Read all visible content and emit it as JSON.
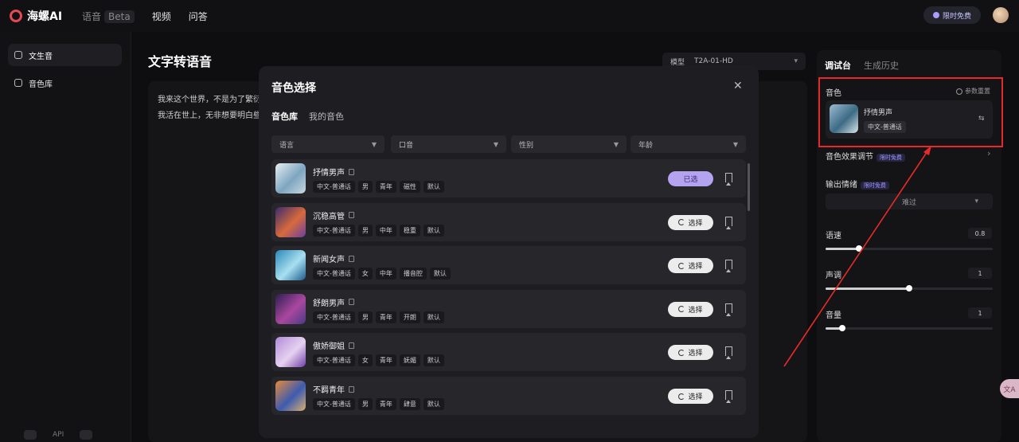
{
  "header": {
    "brand": "海螺AI",
    "nav": [
      {
        "label": "语音",
        "badge": "Beta"
      },
      {
        "label": "视频"
      },
      {
        "label": "问答"
      }
    ],
    "promo_label": "限时免费"
  },
  "sidebar": {
    "items": [
      {
        "label": "文生音",
        "active": true
      },
      {
        "label": "音色库",
        "active": false
      }
    ],
    "bottom": {
      "api_label": "API"
    }
  },
  "main": {
    "title": "文字转语音",
    "model_label": "模型",
    "model_value": "T2A-01-HD",
    "text_lines": [
      "我来这个世界，不是为了繁衍",
      "我活在世上，无非想要明白些"
    ]
  },
  "right_panel": {
    "tabs": [
      "调试台",
      "生成历史"
    ],
    "voice_label": "音色",
    "reset_label": "参数重置",
    "current_voice": {
      "name": "抒情男声",
      "tag": "中文-普通话"
    },
    "effect_label": "音色效果调节",
    "effect_badge": "限时免费",
    "emotion_label": "输出情绪",
    "emotion_badge": "限时免费",
    "emotion_value": "难过",
    "speed": {
      "label": "语速",
      "value": "0.8",
      "fraction": 0.2
    },
    "pitch": {
      "label": "声调",
      "value": "1",
      "fraction": 0.5
    },
    "volume": {
      "label": "音量",
      "value": "1",
      "fraction": 0.1
    }
  },
  "modal": {
    "title": "音色选择",
    "tabs": [
      "音色库",
      "我的音色"
    ],
    "filters": [
      "语言",
      "口音",
      "性别",
      "年龄"
    ],
    "select_label": "选择",
    "selected_label": "已选",
    "voices": [
      {
        "name": "抒情男声",
        "tags": [
          "中文-普通话",
          "男",
          "青年",
          "磁性",
          "默认"
        ],
        "selected": true,
        "colors": [
          "#e8eef2",
          "#7ea6c0",
          "#c9d8e2"
        ]
      },
      {
        "name": "沉稳高管",
        "tags": [
          "中文-普通话",
          "男",
          "中年",
          "稳重",
          "默认"
        ],
        "selected": false,
        "colors": [
          "#3b2c6e",
          "#d76a3c",
          "#6a3fa0"
        ]
      },
      {
        "name": "新闻女声",
        "tags": [
          "中文-普通话",
          "女",
          "中年",
          "播音腔",
          "默认"
        ],
        "selected": false,
        "colors": [
          "#2a87b8",
          "#a8dff0",
          "#1c5c8a"
        ]
      },
      {
        "name": "舒朗男声",
        "tags": [
          "中文-普通话",
          "男",
          "青年",
          "开朗",
          "默认"
        ],
        "selected": false,
        "colors": [
          "#2c1f52",
          "#a9479e",
          "#4b3a86"
        ]
      },
      {
        "name": "傲娇御姐",
        "tags": [
          "中文-普通话",
          "女",
          "青年",
          "妩媚",
          "默认"
        ],
        "selected": false,
        "colors": [
          "#b28ad8",
          "#e6d2f0",
          "#6f3fa8"
        ]
      },
      {
        "name": "不羁青年",
        "tags": [
          "中文-普通话",
          "男",
          "青年",
          "肆意",
          "默认"
        ],
        "selected": false,
        "colors": [
          "#e78a3a",
          "#3d5bb0",
          "#d9b070"
        ]
      }
    ]
  }
}
